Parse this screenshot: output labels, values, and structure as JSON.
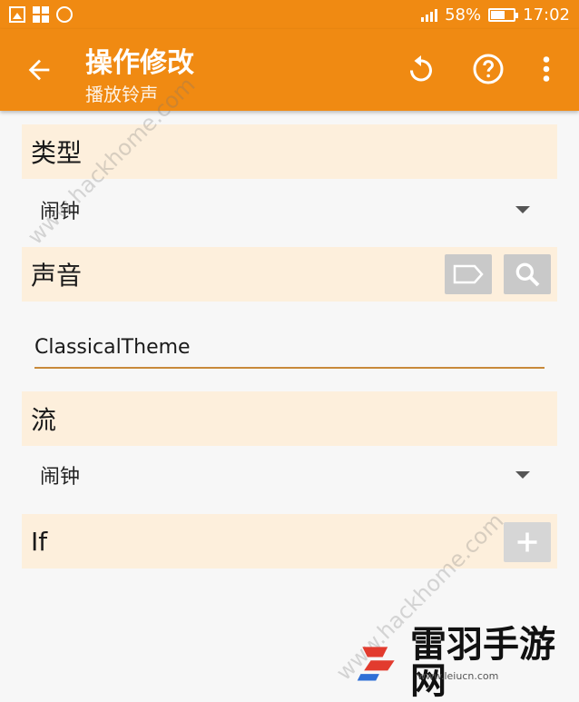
{
  "status_bar": {
    "battery": "58%",
    "time": "17:02"
  },
  "app_bar": {
    "title": "操作修改",
    "subtitle": "播放铃声"
  },
  "sections": {
    "type": {
      "label": "类型",
      "value": "闹钟"
    },
    "sound": {
      "label": "声音",
      "value": "ClassicalTheme"
    },
    "stream": {
      "label": "流",
      "value": "闹钟"
    },
    "if": {
      "label": "If"
    }
  },
  "watermarks": {
    "top": "www.hackhome.com",
    "bottom": "www.hackhome.com"
  },
  "footer": {
    "brand": "雷羽手游网",
    "url": "www.leiucn.com"
  },
  "colors": {
    "accent": "#f08a12",
    "section_bg": "#fdefdc",
    "underline": "#c8893a",
    "button_gray": "#c9c9c9"
  },
  "icons": [
    "back-arrow-icon",
    "undo-icon",
    "help-icon",
    "more-vert-icon",
    "label-tag-icon",
    "search-icon",
    "plus-icon",
    "chevron-down-icon"
  ]
}
